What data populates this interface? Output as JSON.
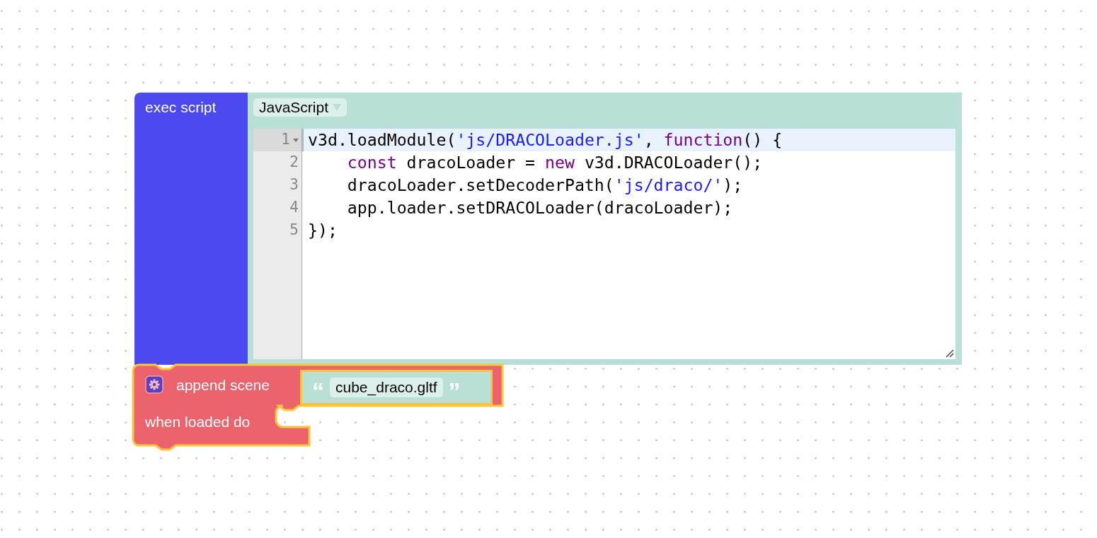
{
  "exec_block": {
    "label": "exec script",
    "language": "JavaScript",
    "code": [
      {
        "number": "1",
        "foldable": true,
        "active": true,
        "indented": false,
        "tokens": [
          {
            "kind": "plain",
            "text": "v3d.loadModule("
          },
          {
            "kind": "string",
            "text": "'js/DRACOLoader.js'"
          },
          {
            "kind": "plain",
            "text": ", "
          },
          {
            "kind": "keyword",
            "text": "function"
          },
          {
            "kind": "plain",
            "text": "() {"
          }
        ]
      },
      {
        "number": "2",
        "foldable": false,
        "active": false,
        "indented": true,
        "tokens": [
          {
            "kind": "keyword",
            "text": "const"
          },
          {
            "kind": "plain",
            "text": " dracoLoader = "
          },
          {
            "kind": "keyword",
            "text": "new"
          },
          {
            "kind": "plain",
            "text": " v3d.DRACOLoader();"
          }
        ]
      },
      {
        "number": "3",
        "foldable": false,
        "active": false,
        "indented": true,
        "tokens": [
          {
            "kind": "plain",
            "text": "dracoLoader.setDecoderPath("
          },
          {
            "kind": "string",
            "text": "'js/draco/'"
          },
          {
            "kind": "plain",
            "text": ");"
          }
        ]
      },
      {
        "number": "4",
        "foldable": false,
        "active": false,
        "indented": true,
        "tokens": [
          {
            "kind": "plain",
            "text": "app.loader.setDRACOLoader(dracoLoader);"
          }
        ]
      },
      {
        "number": "5",
        "foldable": false,
        "active": false,
        "indented": false,
        "tokens": [
          {
            "kind": "plain",
            "text": "});"
          }
        ]
      }
    ]
  },
  "append_block": {
    "label": "append scene",
    "open_quote": "“",
    "value": "cube_draco.gltf",
    "close_quote": "”",
    "statement_label": "when loaded do"
  }
}
